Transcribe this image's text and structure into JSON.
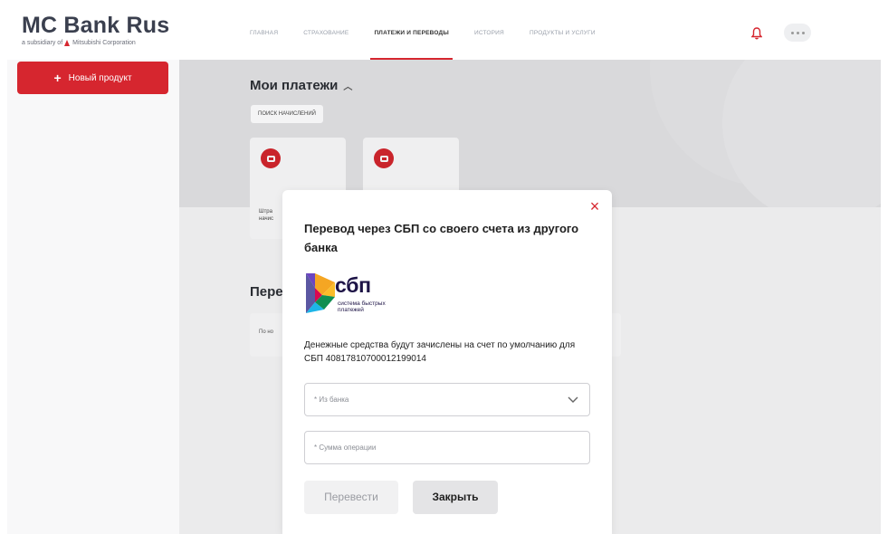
{
  "header": {
    "logo_title": "MC Bank Rus",
    "logo_subtitle_prefix": "a subsidiary of",
    "logo_subtitle_brand": "Mitsubishi Corporation",
    "nav_tabs": [
      {
        "label": "Главная",
        "active": false
      },
      {
        "label": "Страхование",
        "active": false
      },
      {
        "label": "Платежи и переводы",
        "active": true
      },
      {
        "label": "История",
        "active": false
      },
      {
        "label": "Продукты и услуги",
        "active": false
      }
    ],
    "notification_icon": "bell-icon",
    "more_icon": "more-dots-icon"
  },
  "sidebar": {
    "new_product_button": "Новый продукт"
  },
  "background_page": {
    "section_title": "Мои платежи",
    "search_chip": "Поиск начислений",
    "cards": [
      {
        "icon": "car-icon",
        "label_partial": "Штра\nначис"
      },
      {
        "icon": "tax-icon",
        "label_partial": ""
      }
    ],
    "section2_title_partial": "Пере",
    "row_text_partial": "По но"
  },
  "modal": {
    "title": "Перевод через СБП со своего счета из другого банка",
    "logo_word": "сбп",
    "logo_subtitle": "система быстрых платежей",
    "description": "Денежные средства будут зачислены на счет по умолчанию для СБП 40817810700012199014",
    "bank_select_placeholder": "* Из банка",
    "amount_placeholder": "* Сумма операции",
    "submit_button": "Перевести",
    "close_button": "Закрыть",
    "close_icon": "close-icon"
  },
  "colors": {
    "accent": "#d6262f",
    "logo_text": "#3a3f4e",
    "sbp_dark": "#1d1346"
  }
}
